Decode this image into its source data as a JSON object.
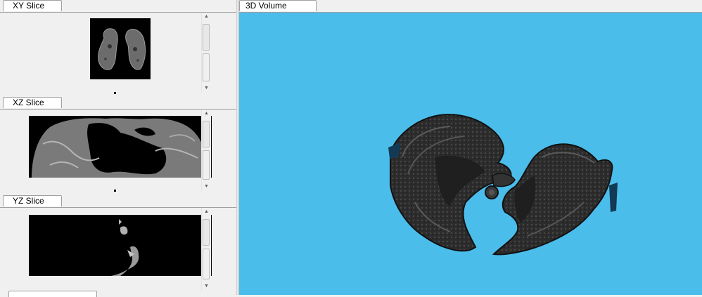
{
  "panels": {
    "xy": {
      "tab_label": "XY Slice"
    },
    "xz": {
      "tab_label": "XZ Slice"
    },
    "yz": {
      "tab_label": "YZ Slice"
    }
  },
  "volume": {
    "tab_label": "3D Volume",
    "background_color": "#4BBDEB"
  },
  "icons": {
    "scroll_up": "▲",
    "scroll_down": "▼"
  }
}
